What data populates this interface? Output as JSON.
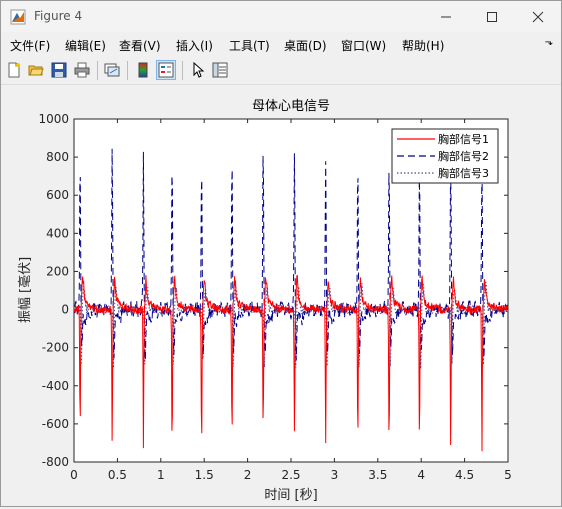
{
  "window": {
    "title": "Figure 4"
  },
  "menu": {
    "items": [
      "文件(F)",
      "编辑(E)",
      "查看(V)",
      "插入(I)",
      "工具(T)",
      "桌面(D)",
      "窗口(W)",
      "帮助(H)"
    ],
    "overflow": "⬎"
  },
  "toolbar": {
    "icons": [
      "new-figure-icon",
      "open-file-icon",
      "save-icon",
      "print-icon",
      "link-plot-icon",
      "insert-colorbar-icon",
      "insert-legend-icon",
      "pointer-icon",
      "property-inspector-icon"
    ]
  },
  "chart_data": {
    "type": "line",
    "title": "母体心电信号",
    "xlabel": "时间 [秒]",
    "ylabel": "振幅 [毫伏]",
    "xlim": [
      0,
      5
    ],
    "ylim": [
      -800,
      1000
    ],
    "xticks": [
      "0",
      "0.5",
      "1",
      "1.5",
      "2",
      "2.5",
      "3",
      "3.5",
      "4",
      "4.5",
      "5"
    ],
    "yticks": [
      "1000",
      "800",
      "600",
      "400",
      "200",
      "0",
      "-200",
      "-400",
      "-600",
      "-800"
    ],
    "grid": false,
    "legend_position": "top-right",
    "colors": {
      "series1": "#ff0000",
      "series2": "#00008b",
      "series3": "#4b4b8f"
    },
    "beat_times": [
      0.07,
      0.44,
      0.8,
      1.13,
      1.47,
      1.82,
      2.18,
      2.54,
      2.9,
      3.27,
      3.63,
      3.98,
      4.34,
      4.7
    ],
    "series": [
      {
        "name": "胸部信号1",
        "style": "solid",
        "peak_values": [
          -640,
          -710,
          -720,
          -735,
          -745,
          -695,
          -655,
          -680,
          -690,
          -720,
          -710,
          -700,
          -720,
          -750
        ]
      },
      {
        "name": "胸部信号2",
        "style": "dashed",
        "peak_values": [
          800,
          820,
          820,
          790,
          770,
          800,
          860,
          820,
          810,
          800,
          790,
          790,
          800,
          820
        ]
      },
      {
        "name": "胸部信号3",
        "style": "dotted",
        "peak_values": [
          -280,
          -300,
          -290,
          -300,
          -290,
          -300,
          -290,
          -300,
          -290,
          -300,
          -290,
          -300,
          -290,
          -300
        ]
      }
    ]
  }
}
